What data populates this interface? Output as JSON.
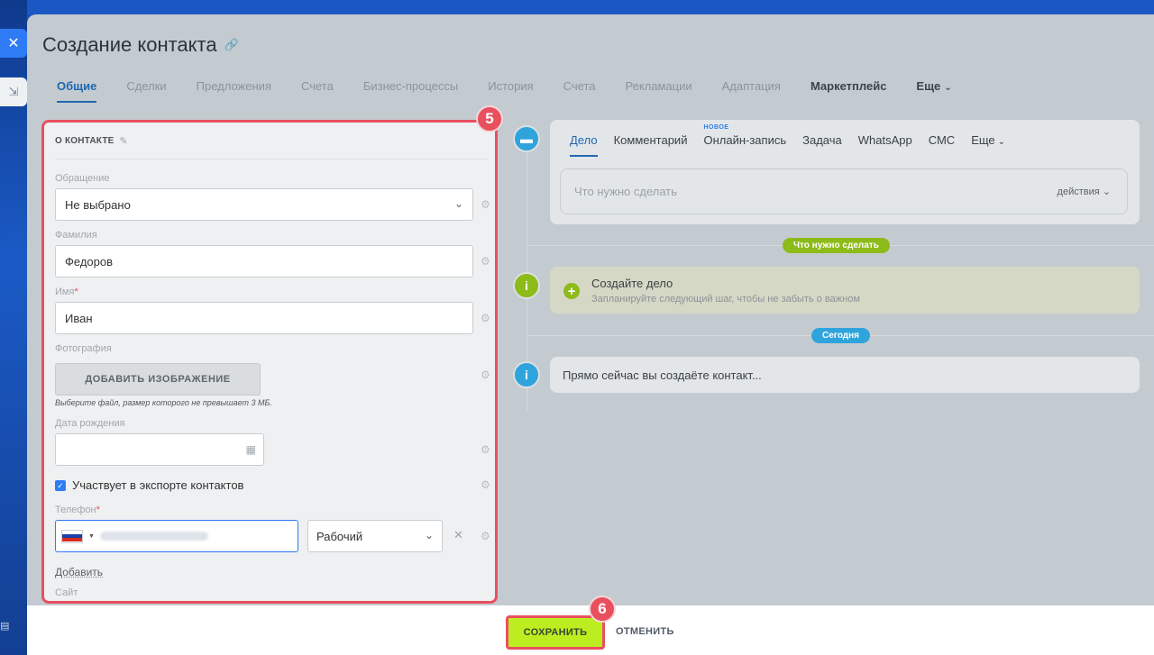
{
  "window": {
    "title": "Создание контакта",
    "close_icon": "close-icon",
    "link_icon": "link-icon"
  },
  "tabs": [
    {
      "label": "Общие",
      "active": true
    },
    {
      "label": "Сделки"
    },
    {
      "label": "Предложения"
    },
    {
      "label": "Счета"
    },
    {
      "label": "Бизнес-процессы"
    },
    {
      "label": "История"
    },
    {
      "label": "Счета"
    },
    {
      "label": "Рекламации"
    },
    {
      "label": "Адаптация"
    },
    {
      "label": "Маркетплейс",
      "bold": true
    },
    {
      "label": "Еще"
    }
  ],
  "form": {
    "section_title": "О КОНТАКТЕ",
    "salutation": {
      "label": "Обращение",
      "value": "Не выбрано"
    },
    "last_name": {
      "label": "Фамилия",
      "value": "Федоров"
    },
    "first_name": {
      "label": "Имя",
      "required_mark": "*",
      "value": "Иван"
    },
    "photo": {
      "label": "Фотография",
      "button": "ДОБАВИТЬ ИЗОБРАЖЕНИЕ",
      "hint": "Выберите файл, размер которого не превышает 3 МБ."
    },
    "birthdate": {
      "label": "Дата рождения",
      "value": ""
    },
    "export": {
      "label": "Участвует в экспорте контактов",
      "checked": true
    },
    "phone": {
      "label": "Телефон",
      "required_mark": "*",
      "type": "Рабочий"
    },
    "add_link": "Добавить",
    "site_label": "Сайт"
  },
  "badges": {
    "form": "5",
    "save": "6"
  },
  "activity": {
    "tabs": [
      {
        "label": "Дело",
        "active": true
      },
      {
        "label": "Комментарий"
      },
      {
        "label": "Онлайн-запись",
        "badge": "НОВОЕ"
      },
      {
        "label": "Задача"
      },
      {
        "label": "WhatsApp"
      },
      {
        "label": "СМС"
      },
      {
        "label": "Еще"
      }
    ],
    "placeholder": "Что нужно сделать",
    "actions": "действия"
  },
  "timeline": {
    "todo_pill": "Что нужно сделать",
    "todo_title": "Создайте дело",
    "todo_sub": "Запланируйте следующий шаг, чтобы не забыть о важном",
    "today_pill": "Сегодня",
    "now_text": "Прямо сейчас вы создаёте контакт..."
  },
  "footer": {
    "save": "СОХРАНИТЬ",
    "cancel": "ОТМЕНИТЬ"
  },
  "colors": {
    "accent_blue": "#2067b0",
    "highlight_red": "#e9505e",
    "save_green": "#bbed21",
    "todo_green": "#8dbb19",
    "today_blue": "#2fa4dc"
  }
}
